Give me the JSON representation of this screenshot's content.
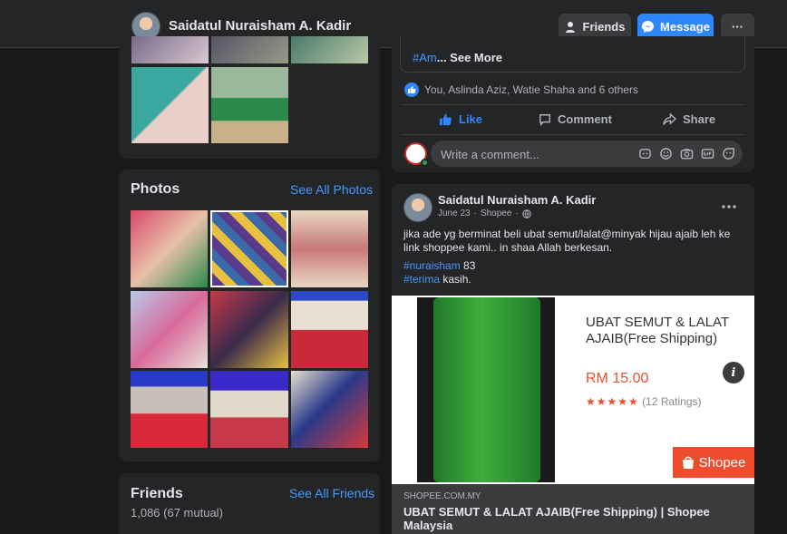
{
  "header": {
    "profile_name": "Saidatul Nuraisham A. Kadir",
    "friends_label": "Friends",
    "message_label": "Message",
    "more_label": "···"
  },
  "photos_card": {
    "title": "Photos",
    "see_all": "See All Photos"
  },
  "friends_card": {
    "title": "Friends",
    "see_all": "See All Friends",
    "count": "1,086 (67 mutual)"
  },
  "post1": {
    "hashtag_fragment": "#Am",
    "see_more": "... See More",
    "reactions_text": "You, Aslinda Aziz, Watie Shaha and 6 others",
    "like_label": "Like",
    "comment_label": "Comment",
    "share_label": "Share",
    "comment_placeholder": "Write a comment..."
  },
  "post2": {
    "author": "Saidatul Nuraisham A. Kadir",
    "date": "June 23",
    "source": "Shopee",
    "text_line": "jika ade yg berminat beli ubat semut/lalat@minyak hijau ajaib leh ke link shoppee kami.. in shaa Allah berkesan.",
    "hashtag1": "#nuraisham",
    "hashtag1_suffix": " 83",
    "hashtag2": "#terima",
    "hashtag2_suffix": " kasih.",
    "product_title": "UBAT SEMUT & LALAT AJAIB(Free Shipping)",
    "product_price": "RM 15.00",
    "product_stars": "★★★★★",
    "product_ratings": "(12 Ratings)",
    "shopee_badge": "Shopee",
    "link_domain": "SHOPEE.COM.MY",
    "link_title": "UBAT SEMUT & LALAT AJAIB(Free Shipping) | Shopee Malaysia"
  },
  "colors": {
    "accent": "#2d88ff",
    "link": "#4599ff",
    "shopee": "#ee4d2d",
    "background": "#18191a",
    "card": "#242526"
  }
}
